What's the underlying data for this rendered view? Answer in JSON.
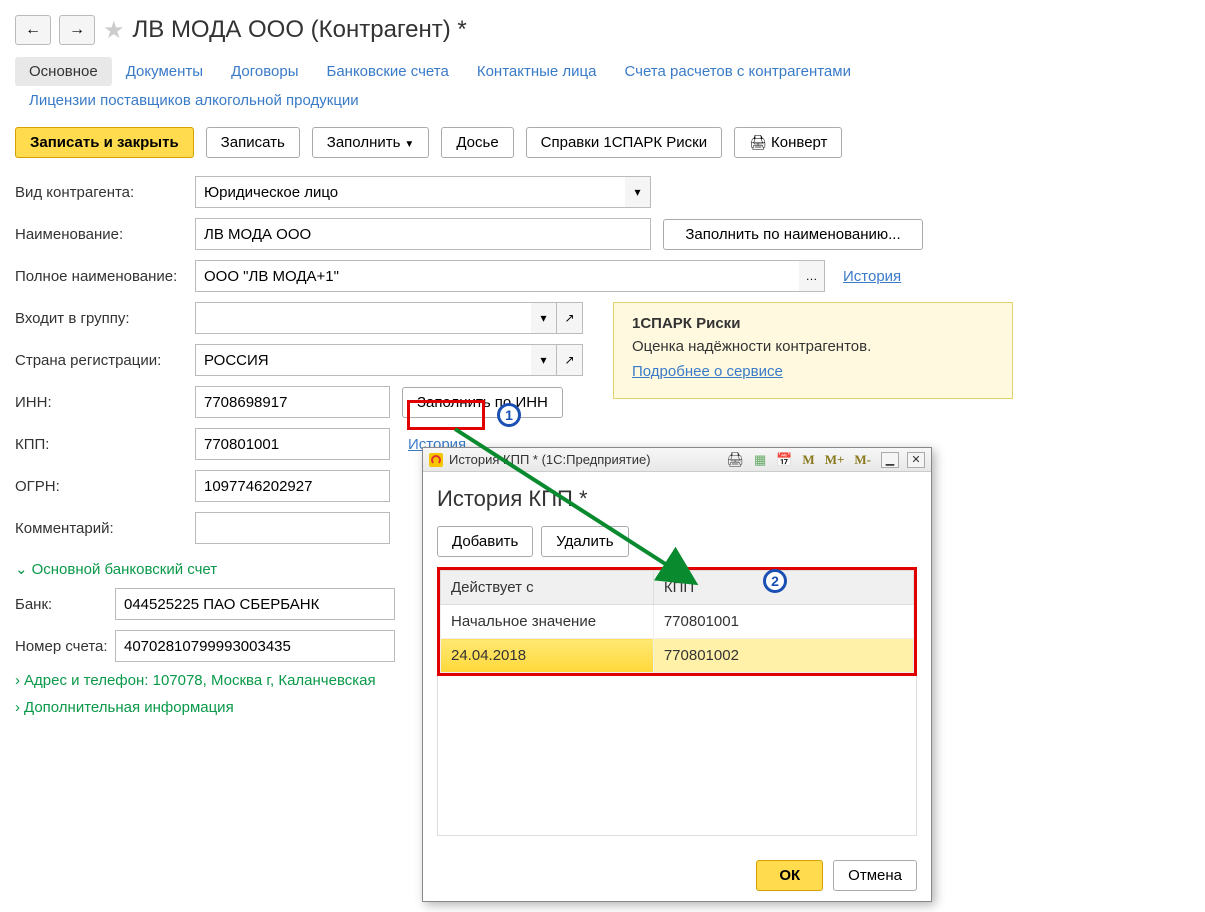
{
  "header": {
    "title": "ЛВ МОДА ООО (Контрагент) *"
  },
  "tabs": {
    "main": "Основное",
    "documents": "Документы",
    "contracts": "Договоры",
    "bank_accounts": "Банковские счета",
    "contact_persons": "Контактные лица",
    "settlements": "Счета расчетов с контрагентами",
    "alcohol_licenses": "Лицензии поставщиков алкогольной продукции"
  },
  "toolbar": {
    "write_close": "Записать и закрыть",
    "write": "Записать",
    "fill": "Заполнить",
    "dossier": "Досье",
    "spark": "Справки 1СПАРК Риски",
    "envelope": "Конверт"
  },
  "form": {
    "type_label": "Вид контрагента:",
    "type_value": "Юридическое лицо",
    "name_label": "Наименование:",
    "name_value": "ЛВ МОДА ООО",
    "fill_by_name": "Заполнить по наименованию...",
    "fullname_label": "Полное наименование:",
    "fullname_value": "ООО \"ЛВ МОДА+1\"",
    "history_link": "История",
    "group_label": "Входит в группу:",
    "group_value": "",
    "country_label": "Страна регистрации:",
    "country_value": "РОССИЯ",
    "inn_label": "ИНН:",
    "inn_value": "7708698917",
    "fill_by_inn": "Заполнить по ИНН",
    "kpp_label": "КПП:",
    "kpp_value": "770801001",
    "kpp_history": "История",
    "ogrn_label": "ОГРН:",
    "ogrn_value": "1097746202927",
    "comment_label": "Комментарий:",
    "comment_value": ""
  },
  "info": {
    "title": "1СПАРК Риски",
    "text": "Оценка надёжности контрагентов.",
    "more": "Подробнее о сервисе"
  },
  "bank": {
    "section": "Основной банковский счет",
    "bank_label": "Банк:",
    "bank_value": "044525225 ПАО СБЕРБАНК",
    "account_label": "Номер счета:",
    "account_value": "40702810799993003435"
  },
  "sections": {
    "address": "Адрес и телефон: 107078, Москва г, Каланчевская",
    "additional": "Дополнительная информация"
  },
  "dialog": {
    "window_title": "История КПП * (1С:Предприятие)",
    "title": "История КПП *",
    "add": "Добавить",
    "delete": "Удалить",
    "col_from": "Действует с",
    "col_kpp": "КПП",
    "row0_from": "Начальное значение",
    "row0_kpp": "770801001",
    "row1_from": "24.04.2018",
    "row1_kpp": "770801002",
    "ok": "ОК",
    "cancel": "Отмена",
    "m": "M",
    "mplus": "M+",
    "mminus": "M-"
  },
  "callouts": {
    "n1": "1",
    "n2": "2"
  }
}
